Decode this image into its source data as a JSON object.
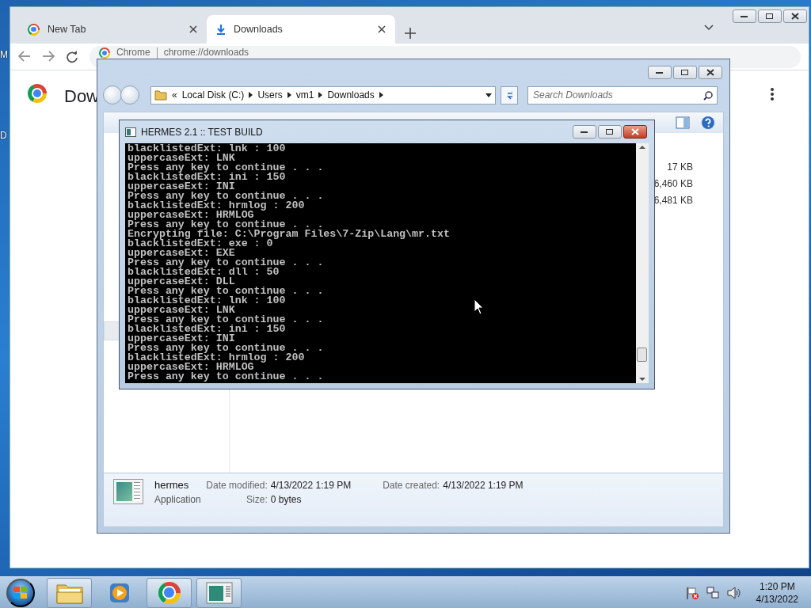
{
  "desktop": {
    "labels": [
      "M",
      "D"
    ]
  },
  "browser": {
    "tabs": [
      {
        "label": "New Tab",
        "selected": false
      },
      {
        "label": "Downloads",
        "selected": true
      }
    ],
    "address": {
      "site": "Chrome",
      "url": "chrome://downloads"
    },
    "page_title": "Dow"
  },
  "explorer": {
    "overflow": "«",
    "breadcrumb": [
      "Local Disk (C:)",
      "Users",
      "vm1",
      "Downloads"
    ],
    "search": {
      "placeholder": "Search Downloads"
    },
    "sizes": [
      "17 KB",
      "6,460 KB",
      "6,481 KB"
    ],
    "details": {
      "name": "hermes",
      "type": "Application",
      "fields": [
        {
          "label": "Date modified:",
          "value": "4/13/2022 1:19 PM"
        },
        {
          "label": "Date created:",
          "value": "4/13/2022 1:19 PM"
        },
        {
          "label": "Size:",
          "value": "0 bytes"
        }
      ]
    }
  },
  "console": {
    "title": "HERMES 2.1 :: TEST BUILD",
    "lines": [
      "blacklistedExt: lnk : 100",
      "uppercaseExt: LNK",
      "Press any key to continue . . .",
      "blacklistedExt: ini : 150",
      "uppercaseExt: INI",
      "Press any key to continue . . .",
      "blacklistedExt: hrmlog : 200",
      "uppercaseExt: HRMLOG",
      "Press any key to continue . . .",
      "Encrypting file: C:\\Program Files\\7-Zip\\Lang\\mr.txt",
      "blacklistedExt: exe : 0",
      "uppercaseExt: EXE",
      "Press any key to continue . . .",
      "blacklistedExt: dll : 50",
      "uppercaseExt: DLL",
      "Press any key to continue . . .",
      "blacklistedExt: lnk : 100",
      "uppercaseExt: LNK",
      "Press any key to continue . . .",
      "blacklistedExt: ini : 150",
      "uppercaseExt: INI",
      "Press any key to continue . . .",
      "blacklistedExt: hrmlog : 200",
      "uppercaseExt: HRMLOG",
      "Press any key to continue . . ."
    ]
  },
  "taskbar": {
    "apps": [
      {
        "kind": "folder",
        "running": true
      },
      {
        "kind": "media",
        "running": false
      },
      {
        "kind": "chrome",
        "running": true
      },
      {
        "kind": "console",
        "running": true
      }
    ],
    "clock": {
      "time": "1:20 PM",
      "date": "4/13/2022"
    }
  }
}
